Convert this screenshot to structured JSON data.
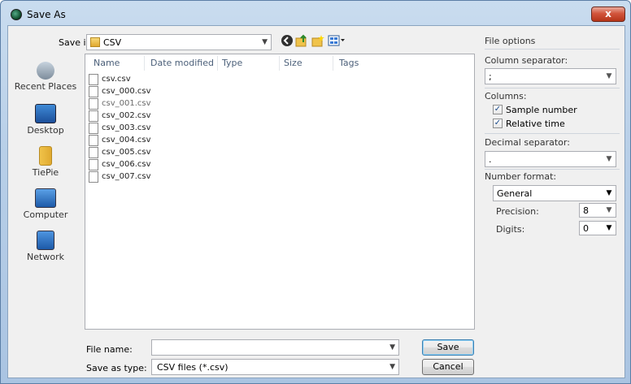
{
  "window": {
    "title": "Save As",
    "close_glyph": "x"
  },
  "header": {
    "save_in_label": "Save in:",
    "save_in_value": "CSV"
  },
  "places": [
    {
      "label": "Recent Places",
      "icon": "recent-places-icon"
    },
    {
      "label": "Desktop",
      "icon": "desktop-icon"
    },
    {
      "label": "TiePie",
      "icon": "tiepie-icon"
    },
    {
      "label": "Computer",
      "icon": "computer-icon"
    },
    {
      "label": "Network",
      "icon": "network-icon"
    }
  ],
  "columns": [
    "Name",
    "Date modified",
    "Type",
    "Size",
    "Tags"
  ],
  "files": [
    "csv.csv",
    "csv_000.csv",
    "csv_001.csv",
    "csv_002.csv",
    "csv_003.csv",
    "csv_004.csv",
    "csv_005.csv",
    "csv_006.csv",
    "csv_007.csv"
  ],
  "footer": {
    "file_name_label": "File name:",
    "file_name_value": "",
    "save_as_type_label": "Save as type:",
    "save_as_type_value": "CSV files (*.csv)",
    "save_button": "Save",
    "cancel_button": "Cancel"
  },
  "options": {
    "header": "File options",
    "column_separator_label": "Column separator:",
    "column_separator_value": ";",
    "columns_label": "Columns:",
    "sample_number_label": "Sample number",
    "sample_number_checked": true,
    "relative_time_label": "Relative time",
    "relative_time_checked": true,
    "decimal_separator_label": "Decimal separator:",
    "decimal_separator_value": ".",
    "number_format_label": "Number format:",
    "number_format_value": "General",
    "precision_label": "Precision:",
    "precision_value": "8",
    "digits_label": "Digits:",
    "digits_value": "0"
  }
}
